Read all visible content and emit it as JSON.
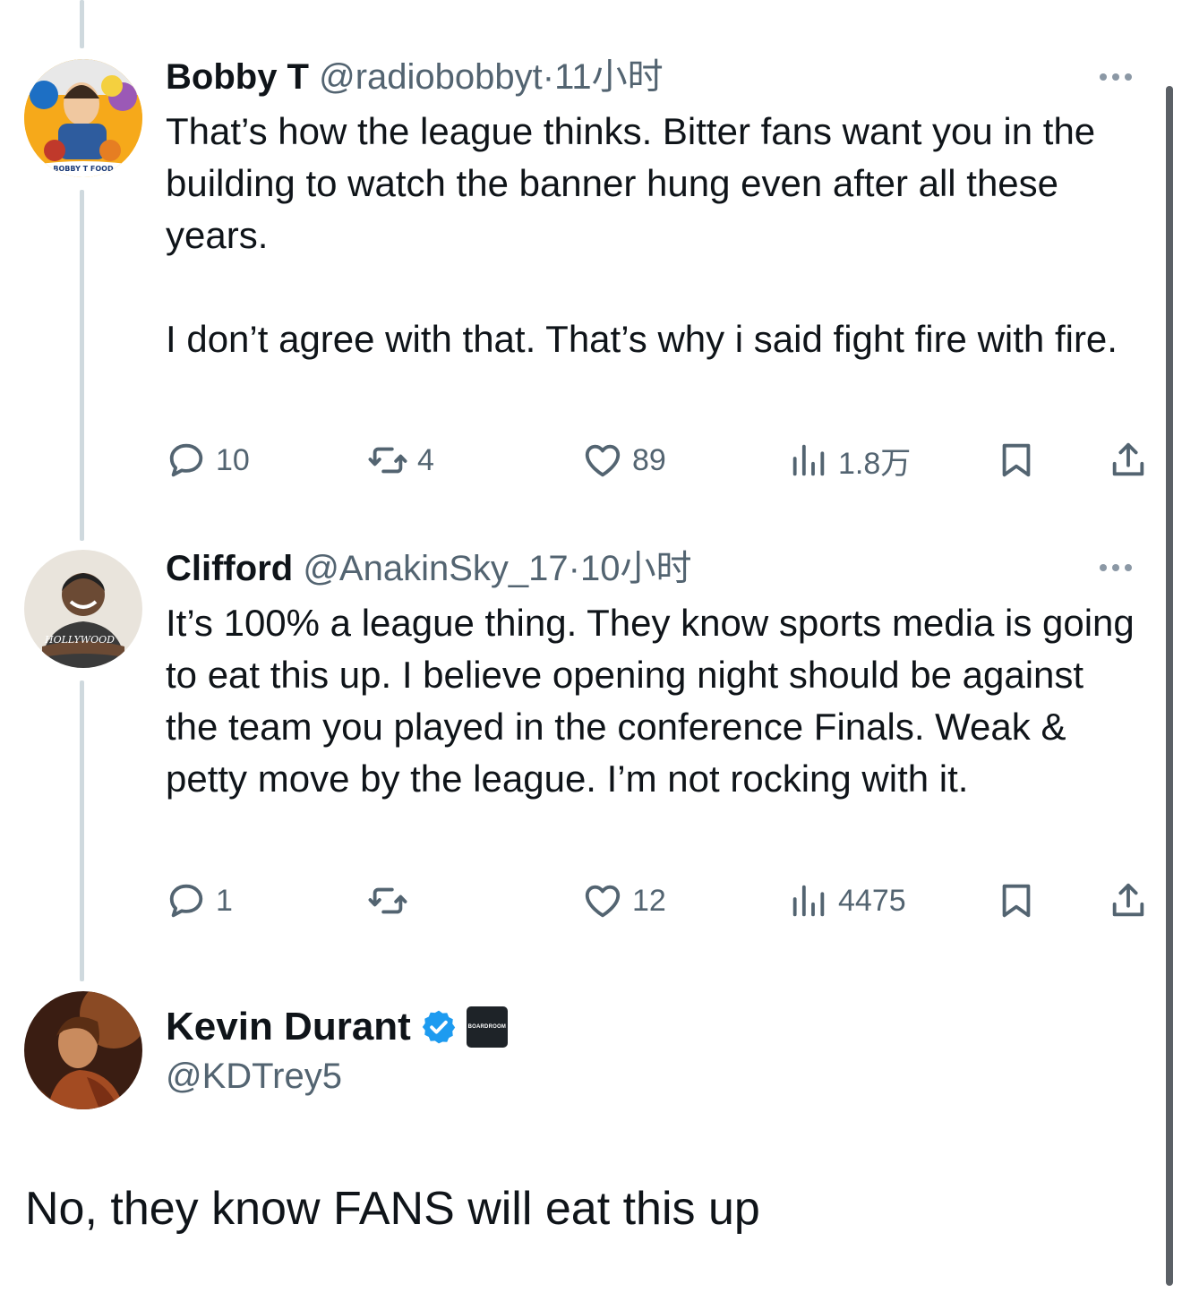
{
  "tweets": [
    {
      "name": "Bobby T",
      "handle": "@radiobobbyt",
      "separator": "·",
      "time": "11小时",
      "paragraphs": [
        "That’s how the league thinks. Bitter fans want you in the building to watch the banner hung even after all these years.",
        "I don’t agree with that. That’s why i said fight fire with fire."
      ],
      "avatar_text": "BOBBY T FOOD",
      "actions": {
        "replies": "10",
        "retweets": "4",
        "likes": "89",
        "views": "1.8万"
      }
    },
    {
      "name": "Clifford",
      "handle": "@AnakinSky_17",
      "separator": "·",
      "time": "10小时",
      "paragraphs": [
        "It’s 100% a league thing. They know sports media is going to eat this up. I believe opening night should be against the team you played in the conference Finals. Weak & petty move by the league. I’m not rocking with it."
      ],
      "avatar_text": "HOLLYWOOD",
      "actions": {
        "replies": "1",
        "retweets": "",
        "likes": "12",
        "views": "4475"
      }
    }
  ],
  "main": {
    "name": "Kevin Durant",
    "handle": "@KDTrey5",
    "affiliate_badge": "BOARDROOM",
    "text": "No, they know FANS will eat this up"
  },
  "icons": {
    "reply": "reply-icon",
    "retweet": "retweet-icon",
    "like": "heart-icon",
    "views": "views-icon",
    "bookmark": "bookmark-icon",
    "share": "share-icon",
    "verified": "verified-badge-icon",
    "more": "more-icon"
  },
  "colors": {
    "text": "#0f1419",
    "secondary": "#536471",
    "verified": "#1d9bf0",
    "thread_line": "#cfd9de"
  }
}
